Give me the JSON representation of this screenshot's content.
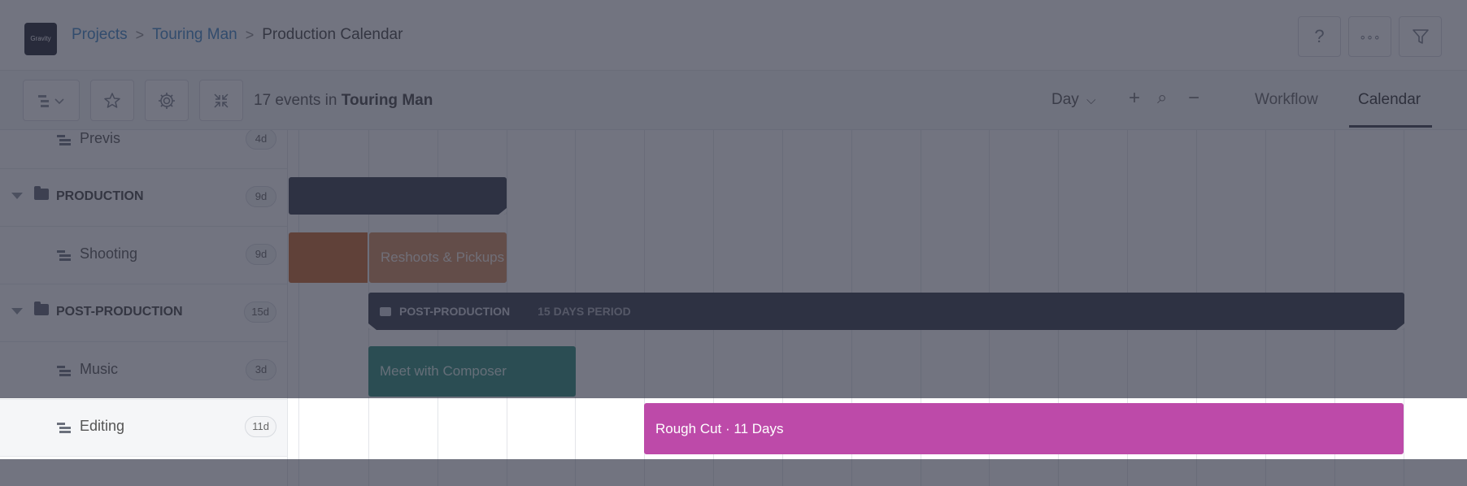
{
  "logo_text": "Gravity",
  "breadcrumb": {
    "projects": "Projects",
    "project": "Touring Man",
    "page": "Production Calendar",
    "separator": ">"
  },
  "header_buttons": [
    {
      "icon": "help-icon",
      "glyph": "?"
    },
    {
      "icon": "more-icon",
      "glyph": "∘∘∘"
    },
    {
      "icon": "filter-icon",
      "glyph": "⏷"
    }
  ],
  "toolbar": {
    "events_prefix": "17 events in",
    "events_project": "Touring Man",
    "scale": "Day",
    "scale_caret": "⌵",
    "zoom_in": "+",
    "zoom_reset": "⌕",
    "zoom_out": "−",
    "tabs": {
      "workflow": "Workflow",
      "calendar": "Calendar"
    },
    "active_tab": "Calendar"
  },
  "rows": {
    "previs": {
      "label": "Previs",
      "badge": "4d"
    },
    "production": {
      "label": "PRODUCTION",
      "badge": "9d"
    },
    "shooting": {
      "label": "Shooting",
      "badge": "9d"
    },
    "post_production": {
      "label": "POST-PRODUCTION",
      "badge": "15d"
    },
    "music": {
      "label": "Music",
      "badge": "3d"
    },
    "editing": {
      "label": "Editing",
      "badge": "11d"
    }
  },
  "events": {
    "reshoots": "Reshoots & Pickups",
    "post_label": "POST-PRODUCTION",
    "post_period": "15 DAYS PERIOD",
    "composer": "Meet with Composer",
    "rough_cut": "Rough Cut · 11 Days"
  },
  "colors": {
    "shoot": "#c9652a",
    "composer": "#2a8a76",
    "rough_cut": "#bd4aa9",
    "group_bar": "#323746",
    "link": "#3d86c6"
  }
}
